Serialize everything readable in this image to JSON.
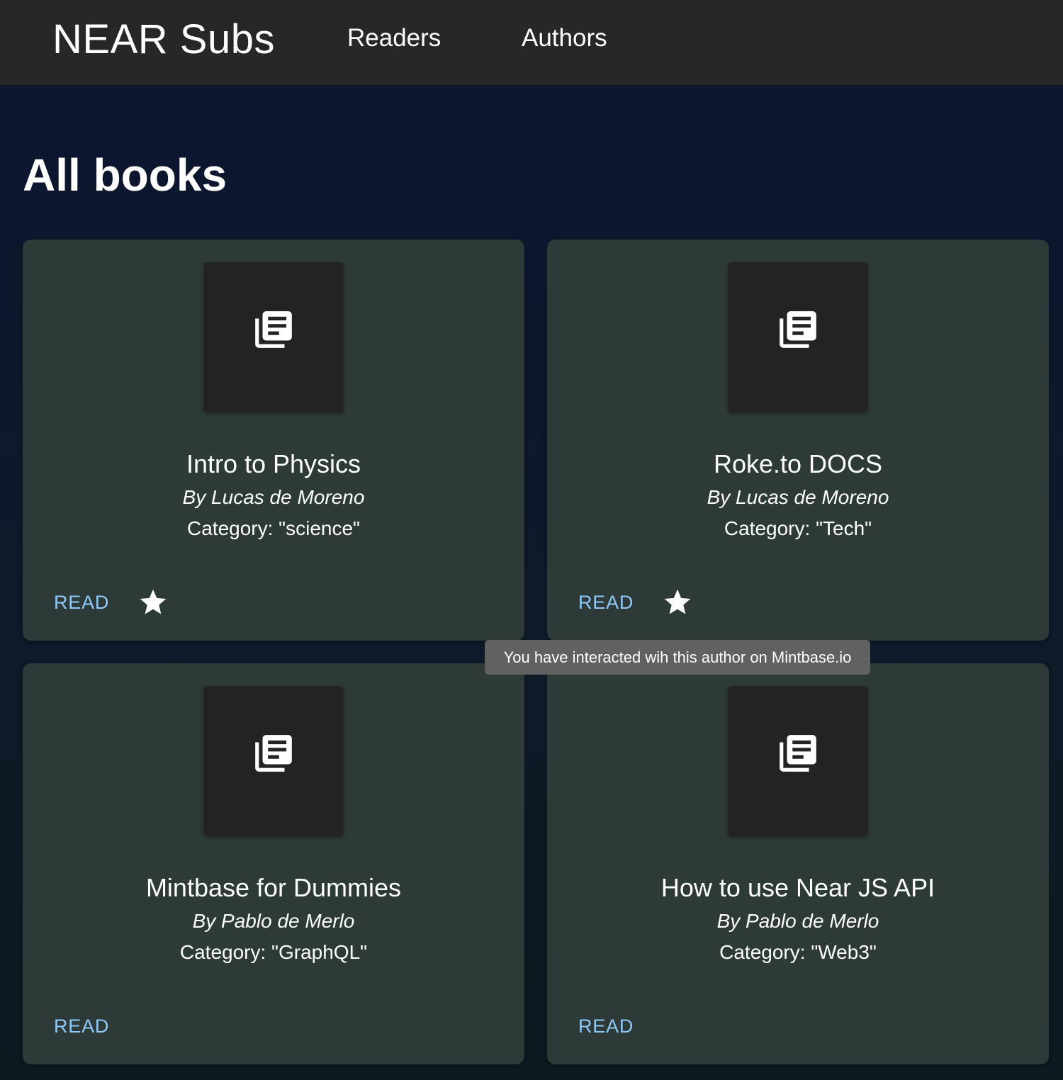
{
  "appbar": {
    "brand": "NEAR Subs",
    "nav": [
      {
        "label": "Readers"
      },
      {
        "label": "Authors"
      }
    ]
  },
  "page": {
    "title": "All books"
  },
  "books": [
    {
      "title": "Intro to Physics",
      "author": "By Lucas de Moreno",
      "category": "Category: \"science\"",
      "read_label": "READ",
      "starred": true,
      "cover_icon": "library-books-icon"
    },
    {
      "title": "Roke.to DOCS",
      "author": "By Lucas de Moreno",
      "category": "Category: \"Tech\"",
      "read_label": "READ",
      "starred": true,
      "cover_icon": "library-books-icon"
    },
    {
      "title": "Mintbase for Dummies",
      "author": "By Pablo de Merlo",
      "category": "Category: \"GraphQL\"",
      "read_label": "READ",
      "starred": false,
      "cover_icon": "library-books-icon"
    },
    {
      "title": "How to use Near JS API",
      "author": "By Pablo de Merlo",
      "category": "Category: \"Web3\"",
      "read_label": "READ",
      "starred": false,
      "cover_icon": "library-books-icon"
    }
  ],
  "tooltip": {
    "text": "You have interacted wih this author on Mintbase.io"
  },
  "colors": {
    "appbar": "#272727",
    "card": "#2d3a38",
    "cover": "#232323",
    "link": "#90caf9",
    "tooltip": "#616161"
  }
}
